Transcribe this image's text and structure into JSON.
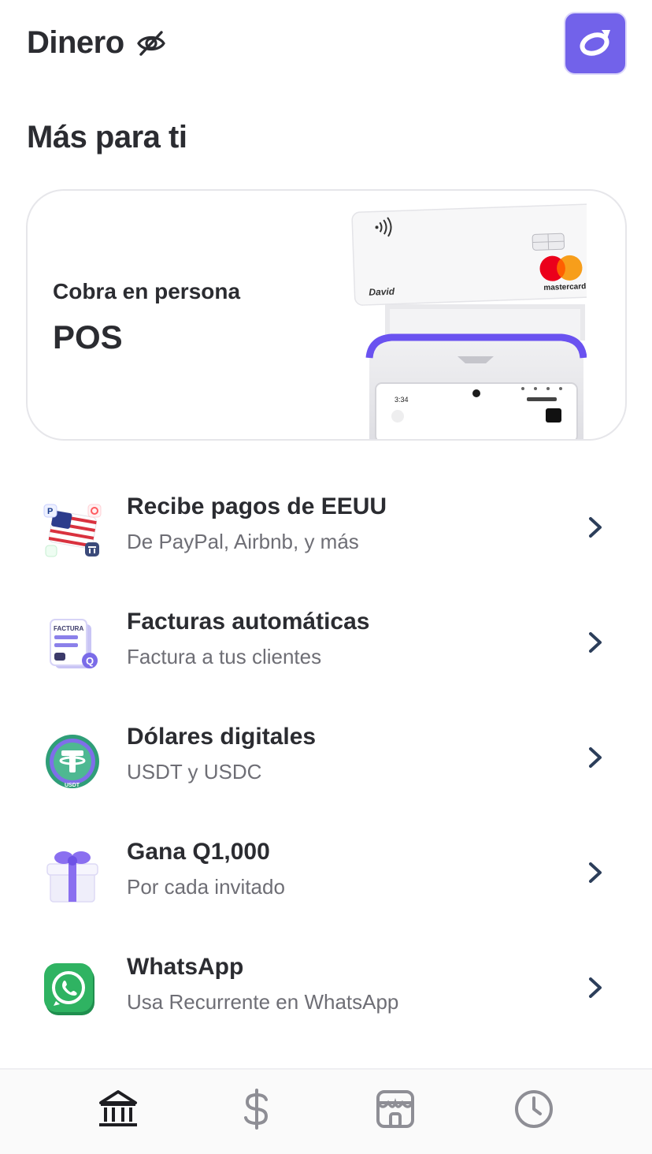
{
  "header": {
    "title": "Dinero",
    "hide_balance_icon": "eye-off-icon",
    "logo_icon": "brand-logo-icon",
    "accent_color": "#7262ea"
  },
  "section": {
    "title": "Más para ti"
  },
  "pos_card": {
    "subtitle": "Cobra en persona",
    "title": "POS",
    "card_name": "David",
    "card_brand": "mastercard",
    "terminal_time": "3:34"
  },
  "items": [
    {
      "title": "Recibe pagos de EEUU",
      "subtitle": "De PayPal, Airbnb, y más",
      "icon": "us-flag-payments-icon"
    },
    {
      "title": "Facturas automáticas",
      "subtitle": "Factura a tus clientes",
      "icon": "invoice-icon",
      "icon_text": "FACTURA"
    },
    {
      "title": "Dólares digitales",
      "subtitle": "USDT y USDC",
      "icon": "tether-coin-icon",
      "icon_text": "USDT"
    },
    {
      "title": "Gana Q1,000",
      "subtitle": "Por cada invitado",
      "icon": "gift-icon"
    },
    {
      "title": "WhatsApp",
      "subtitle": "Usa Recurrente en WhatsApp",
      "icon": "whatsapp-icon"
    }
  ],
  "nav": {
    "items": [
      {
        "icon": "bank-icon",
        "active": true
      },
      {
        "icon": "dollar-icon",
        "active": false
      },
      {
        "icon": "store-icon",
        "active": false
      },
      {
        "icon": "clock-icon",
        "active": false
      }
    ]
  }
}
